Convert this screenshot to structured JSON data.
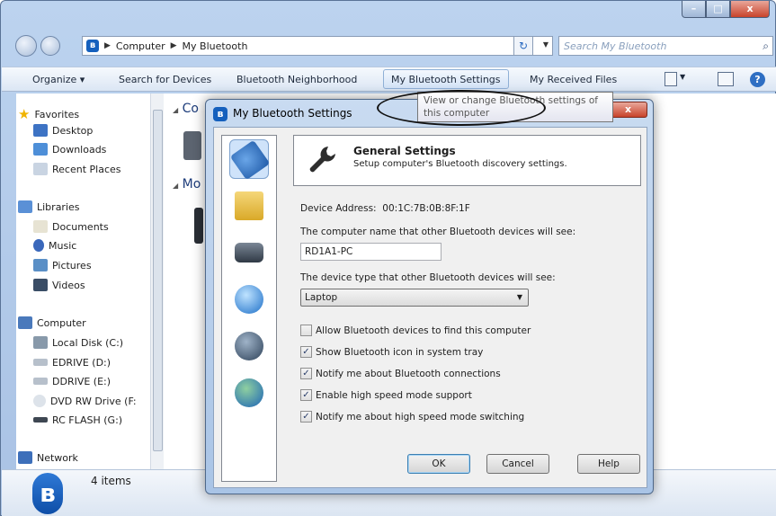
{
  "explorer": {
    "title_buttons": {
      "minimize": "–",
      "maximize": "□",
      "close": "x"
    },
    "breadcrumb": [
      "Computer",
      "My Bluetooth"
    ],
    "search_placeholder": "Search My Bluetooth",
    "commands": [
      "Organize",
      "Search for Devices",
      "Bluetooth Neighborhood",
      "My Bluetooth Settings",
      "My Received Files"
    ],
    "nav": {
      "favorites": {
        "label": "Favorites",
        "items": [
          "Desktop",
          "Downloads",
          "Recent Places"
        ]
      },
      "libraries": {
        "label": "Libraries",
        "items": [
          "Documents",
          "Music",
          "Pictures",
          "Videos"
        ]
      },
      "computer": {
        "label": "Computer",
        "items": [
          "Local Disk (C:)",
          "EDRIVE (D:)",
          "DDRIVE (E:)",
          "DVD RW Drive (F:",
          "RC FLASH (G:)"
        ]
      },
      "network": {
        "label": "Network"
      }
    },
    "groups": [
      "Co",
      "Mo"
    ],
    "status": "4 items"
  },
  "tooltip": {
    "text_line1": "View or change Bluetooth settings of",
    "text_line2": "this computer"
  },
  "dialog": {
    "title": "My Bluetooth Settings",
    "close": "x",
    "header_title": "General Settings",
    "header_subtitle": "Setup computer's Bluetooth discovery settings.",
    "device_address_label": "Device Address:",
    "device_address": "00:1C:7B:0B:8F:1F",
    "name_label": "The computer name that other Bluetooth devices will see:",
    "name_value": "RD1A1-PC",
    "type_label": "The device type that other Bluetooth devices will see:",
    "type_value": "Laptop",
    "options": [
      {
        "label": "Allow Bluetooth devices to find this computer",
        "checked": false
      },
      {
        "label": "Show Bluetooth icon in system tray",
        "checked": true
      },
      {
        "label": "Notify me about Bluetooth connections",
        "checked": true
      },
      {
        "label": "Enable high speed mode support",
        "checked": true
      },
      {
        "label": "Notify me about high speed mode switching",
        "checked": true
      }
    ],
    "buttons": {
      "ok": "OK",
      "cancel": "Cancel",
      "help": "Help"
    }
  },
  "colors": {
    "accent": "#1560bd",
    "title_gradient_top": "#bcd3ef",
    "close_red": "#c8432b"
  }
}
